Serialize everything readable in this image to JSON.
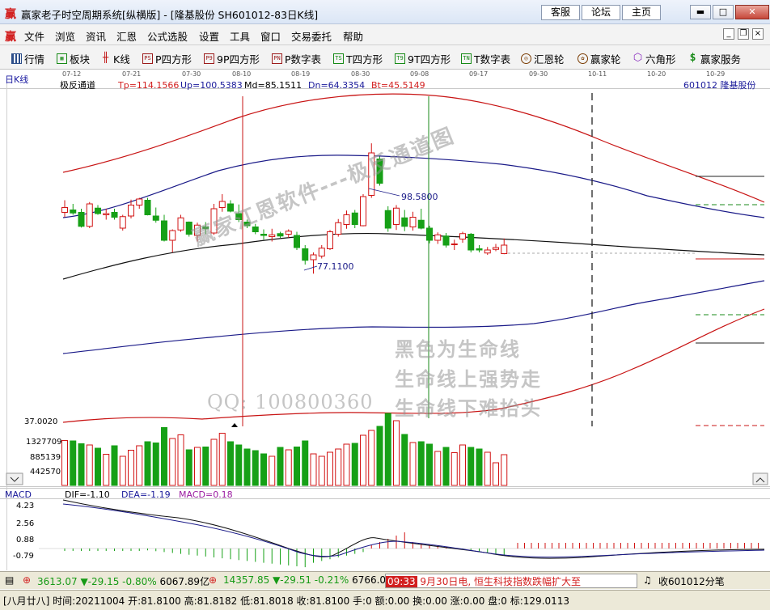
{
  "window": {
    "app_logo": "赢",
    "title": "赢家老子时空周期系统[纵横版] - [隆基股份  SH601012-83日K线]",
    "links": [
      "客服",
      "论坛",
      "主页"
    ]
  },
  "menubar": {
    "logo": "赢",
    "items": [
      "文件",
      "浏览",
      "资讯",
      "汇恩",
      "公式选股",
      "设置",
      "工具",
      "窗口",
      "交易委托",
      "帮助"
    ]
  },
  "toolbar": {
    "items": [
      {
        "label": "行情",
        "icon": "grid-icon"
      },
      {
        "label": "板块",
        "icon": "blocks-icon"
      },
      {
        "label": "K线",
        "icon": "candlestick-icon"
      },
      {
        "label": "P四方形",
        "icon": "ps-icon",
        "glyph": "PS"
      },
      {
        "label": "9P四方形",
        "icon": "p9-icon",
        "glyph": "P9"
      },
      {
        "label": "P数字表",
        "icon": "pn-icon",
        "glyph": "PN"
      },
      {
        "label": "T四方形",
        "icon": "ts-icon",
        "glyph": "TS"
      },
      {
        "label": "9T四方形",
        "icon": "t9-icon",
        "glyph": "T9"
      },
      {
        "label": "T数字表",
        "icon": "tn-icon",
        "glyph": "TN"
      },
      {
        "label": "汇恩轮",
        "icon": "wheel-icon"
      },
      {
        "label": "赢家轮",
        "icon": "winner-wheel-icon"
      },
      {
        "label": "六角形",
        "icon": "hexagon-icon"
      },
      {
        "label": "赢家服务",
        "icon": "service-icon"
      }
    ]
  },
  "chart_header": {
    "period": "日K线",
    "indicator": "极反通道",
    "tp": "Tp=114.1566",
    "up": "Up=100.5383",
    "md": "Md=85.1511",
    "dn": "Dn=64.3354",
    "bt": "Bt=45.5149",
    "stock": "601012  隆基股份"
  },
  "date_ticks": [
    "07-12",
    "07-21",
    "07-30",
    "08-10",
    "08-19",
    "08-30",
    "09-08",
    "09-17",
    "09-30",
    "10-11",
    "10-20",
    "10-29"
  ],
  "annotations": {
    "high_label": "98.5800",
    "low_label": "77.1100",
    "left_axis_low": "37.0020"
  },
  "watermarks": {
    "diagonal": "赢家江恩软件---极反通道图",
    "line1": "黑色为生命线",
    "line2": "生命线上强势走",
    "line3": "生命线下难抬头",
    "qq": "QQ: 100800360"
  },
  "volume_axis": [
    "1327709",
    "885139",
    "442570"
  ],
  "macd": {
    "name": "MACD",
    "dif": "DIF=-1.10",
    "dea": "DEA=-1.19",
    "macd": "MACD=0.18",
    "axis": [
      "4.23",
      "2.56",
      "0.88",
      "-0.79"
    ]
  },
  "chart_data": {
    "type": "candlestick",
    "candles": [
      {
        "o": 87.2,
        "h": 89.2,
        "l": 86.4,
        "c": 88.0
      },
      {
        "o": 87.6,
        "h": 88.6,
        "l": 86.8,
        "c": 87.1
      },
      {
        "o": 87.2,
        "h": 87.8,
        "l": 84.7,
        "c": 84.9
      },
      {
        "o": 84.9,
        "h": 88.9,
        "l": 84.6,
        "c": 88.6
      },
      {
        "o": 87.9,
        "h": 88.4,
        "l": 86.8,
        "c": 87.0
      },
      {
        "o": 86.8,
        "h": 87.8,
        "l": 86.0,
        "c": 87.0
      },
      {
        "o": 87.2,
        "h": 87.8,
        "l": 86.0,
        "c": 86.4
      },
      {
        "o": 84.6,
        "h": 86.8,
        "l": 84.2,
        "c": 86.5
      },
      {
        "o": 86.6,
        "h": 89.3,
        "l": 86.2,
        "c": 88.4
      },
      {
        "o": 88.4,
        "h": 89.6,
        "l": 87.8,
        "c": 89.4
      },
      {
        "o": 89.2,
        "h": 89.6,
        "l": 86.7,
        "c": 86.8
      },
      {
        "o": 86.6,
        "h": 88.0,
        "l": 85.5,
        "c": 85.9
      },
      {
        "o": 85.8,
        "h": 86.8,
        "l": 82.4,
        "c": 82.6
      },
      {
        "o": 82.6,
        "h": 84.4,
        "l": 80.6,
        "c": 84.2
      },
      {
        "o": 84.3,
        "h": 86.8,
        "l": 84.0,
        "c": 86.3
      },
      {
        "o": 85.6,
        "h": 85.7,
        "l": 83.2,
        "c": 83.6
      },
      {
        "o": 83.4,
        "h": 85.5,
        "l": 82.4,
        "c": 85.1
      },
      {
        "o": 84.8,
        "h": 85.6,
        "l": 83.6,
        "c": 84.5
      },
      {
        "o": 83.8,
        "h": 88.6,
        "l": 83.5,
        "c": 87.8
      },
      {
        "o": 88.0,
        "h": 90.2,
        "l": 87.3,
        "c": 89.0
      },
      {
        "o": 88.6,
        "h": 89.2,
        "l": 87.2,
        "c": 87.4
      },
      {
        "o": 87.0,
        "h": 88.5,
        "l": 85.6,
        "c": 86.0
      },
      {
        "o": 85.6,
        "h": 86.0,
        "l": 84.6,
        "c": 85.0
      },
      {
        "o": 84.8,
        "h": 85.3,
        "l": 83.6,
        "c": 84.0
      },
      {
        "o": 83.6,
        "h": 84.4,
        "l": 82.7,
        "c": 83.4
      },
      {
        "o": 83.2,
        "h": 84.5,
        "l": 82.4,
        "c": 83.5
      },
      {
        "o": 83.7,
        "h": 84.0,
        "l": 83.0,
        "c": 83.3
      },
      {
        "o": 83.6,
        "h": 84.4,
        "l": 83.0,
        "c": 84.1
      },
      {
        "o": 83.4,
        "h": 84.0,
        "l": 81.0,
        "c": 81.4
      },
      {
        "o": 81.2,
        "h": 81.8,
        "l": 78.6,
        "c": 79.3
      },
      {
        "o": 79.4,
        "h": 80.6,
        "l": 77.1,
        "c": 80.2
      },
      {
        "o": 80.0,
        "h": 81.8,
        "l": 79.6,
        "c": 81.3
      },
      {
        "o": 81.2,
        "h": 84.3,
        "l": 81.0,
        "c": 84.0
      },
      {
        "o": 83.6,
        "h": 86.1,
        "l": 83.2,
        "c": 85.5
      },
      {
        "o": 85.2,
        "h": 87.5,
        "l": 84.5,
        "c": 86.8
      },
      {
        "o": 87.1,
        "h": 87.6,
        "l": 84.6,
        "c": 85.2
      },
      {
        "o": 85.0,
        "h": 90.2,
        "l": 84.9,
        "c": 89.8
      },
      {
        "o": 90.0,
        "h": 98.58,
        "l": 89.6,
        "c": 97.0
      },
      {
        "o": 96.0,
        "h": 96.4,
        "l": 91.6,
        "c": 92.0
      },
      {
        "o": 87.5,
        "h": 88.2,
        "l": 84.0,
        "c": 84.6
      },
      {
        "o": 85.2,
        "h": 88.4,
        "l": 84.3,
        "c": 87.9
      },
      {
        "o": 86.3,
        "h": 87.6,
        "l": 84.1,
        "c": 84.9
      },
      {
        "o": 84.8,
        "h": 87.3,
        "l": 84.2,
        "c": 86.4
      },
      {
        "o": 85.9,
        "h": 87.8,
        "l": 84.4,
        "c": 84.6
      },
      {
        "o": 84.6,
        "h": 85.0,
        "l": 82.1,
        "c": 82.6
      },
      {
        "o": 82.6,
        "h": 83.9,
        "l": 82.0,
        "c": 83.5
      },
      {
        "o": 83.3,
        "h": 83.8,
        "l": 81.4,
        "c": 81.8
      },
      {
        "o": 81.9,
        "h": 82.7,
        "l": 81.0,
        "c": 82.0
      },
      {
        "o": 82.8,
        "h": 84.0,
        "l": 82.2,
        "c": 83.7
      },
      {
        "o": 83.6,
        "h": 83.8,
        "l": 80.6,
        "c": 81.0
      },
      {
        "o": 81.2,
        "h": 81.8,
        "l": 80.6,
        "c": 81.0
      },
      {
        "o": 80.5,
        "h": 81.5,
        "l": 80.2,
        "c": 81.0
      },
      {
        "o": 81.1,
        "h": 82.0,
        "l": 80.8,
        "c": 81.4
      },
      {
        "o": 80.4,
        "h": 82.9,
        "l": 80.3,
        "c": 81.8
      }
    ],
    "volume": [
      1110000,
      1100000,
      1030000,
      1000000,
      920000,
      770000,
      980000,
      720000,
      870000,
      980000,
      1080000,
      1050000,
      1430000,
      1160000,
      1250000,
      880000,
      940000,
      950000,
      1140000,
      1290000,
      1080000,
      1000000,
      900000,
      860000,
      780000,
      720000,
      940000,
      880000,
      950000,
      1100000,
      780000,
      720000,
      820000,
      900000,
      1020000,
      1040000,
      1240000,
      1360000,
      1460000,
      1780000,
      1600000,
      1260000,
      1060000,
      1080000,
      1020000,
      840000,
      940000,
      810000,
      1000000,
      940000,
      900000,
      820000,
      560000,
      760000
    ],
    "macd_hist": [
      0.18
    ]
  }
}
